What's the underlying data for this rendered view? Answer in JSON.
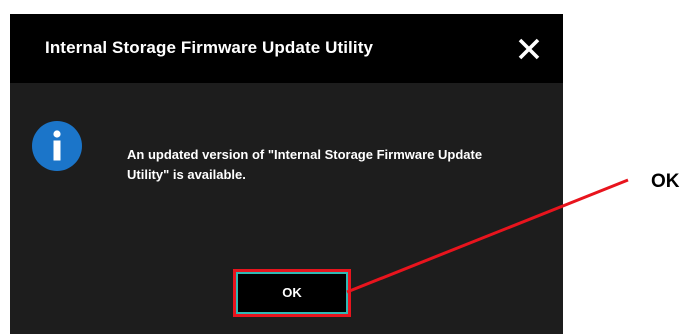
{
  "dialog": {
    "title": "Internal Storage Firmware Update Utility",
    "message": "An updated version of \"Internal Storage Firmware Update Utility\" is available.",
    "ok_label": "OK",
    "icons": {
      "close": "close-icon",
      "info": "info-icon"
    }
  },
  "annotation": {
    "label": "OK"
  },
  "colors": {
    "titlebar": "#000000",
    "dialog_body": "#1d1d1d",
    "info_icon": "#1b75c9",
    "button_border": "#2fb8b4",
    "highlight": "#e8141d"
  }
}
